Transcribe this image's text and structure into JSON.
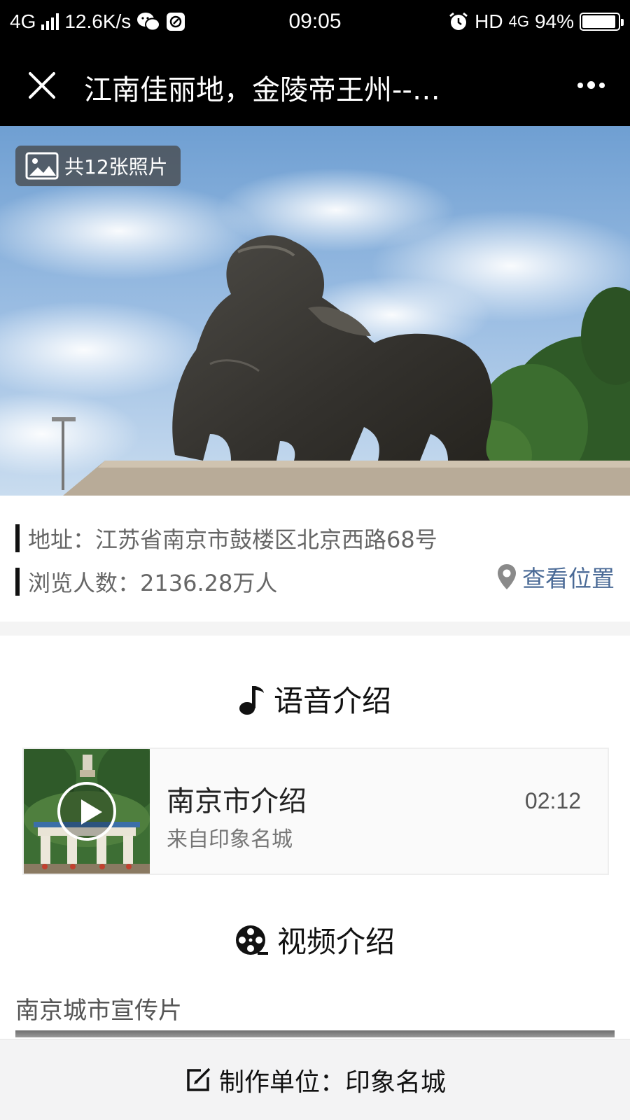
{
  "status_bar": {
    "network": "4G",
    "speed": "12.6K/s",
    "time": "09:05",
    "hd": "HD",
    "network_right": "4G",
    "battery": "94%",
    "battery_level": 0.94
  },
  "title_bar": {
    "title": "江南佳丽地，金陵帝王州--…"
  },
  "hero": {
    "photo_count": "共12张照片"
  },
  "info": {
    "address": "地址：江苏省南京市鼓楼区北京西路68号",
    "views": "浏览人数：2136.28万人",
    "view_location": "查看位置"
  },
  "audio_section": {
    "heading": "语音介绍",
    "item": {
      "title": "南京市介绍",
      "source": "来自印象名城",
      "duration": "02:12"
    }
  },
  "video_section": {
    "heading": "视频介绍",
    "video_title": "南京城市宣传片"
  },
  "footer": {
    "producer": "制作单位：印象名城"
  },
  "colors": {
    "accent_link": "#4a6a96",
    "bar_bg": "#000000",
    "divider": "#f4f4f4"
  }
}
